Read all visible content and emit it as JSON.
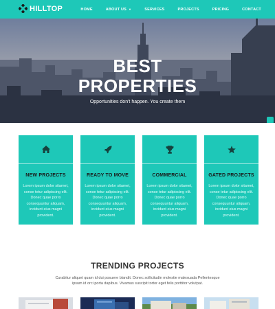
{
  "brand": {
    "name": "HILLTOP",
    "accent_color": "#1ec8b8",
    "logo_icon": "diamond-grid-icon"
  },
  "nav": {
    "items": [
      {
        "label": "HOME",
        "active": true
      },
      {
        "label": "ABOUT US",
        "has_dropdown": true
      },
      {
        "label": "SERVICES"
      },
      {
        "label": "PROJECTS"
      },
      {
        "label": "PRICING"
      },
      {
        "label": "CONTACT"
      }
    ]
  },
  "hero": {
    "title_line1": "BEST",
    "title_line2": "PROPERTIES",
    "subtitle": "Opportunities don't happen. You create them",
    "background": "city-skyline-photo"
  },
  "features": [
    {
      "icon": "home-icon",
      "title": "NEW PROJECTS",
      "text": "Lorem ipsum dolor sitamet, conse tetur adipiscing elit. Donec quae porro consequuntur aliquam, incidunt eius magni provident."
    },
    {
      "icon": "rocket-icon",
      "title": "READY TO MOVE",
      "text": "Lorem ipsum dolor sitamet, conse tetur adipiscing elit. Donec quae porro consequuntur aliquam, incidunt eius magni provident."
    },
    {
      "icon": "trophy-icon",
      "title": "COMMERCIAL",
      "text": "Lorem ipsum dolor sitamet, conse tetur adipiscing elit. Donec quae porro consequuntur aliquam, incidunt eius magni provident."
    },
    {
      "icon": "star-icon",
      "title": "GATED PROJECTS",
      "text": "Lorem ipsum dolor sitamet, conse tetur adipiscing elit. Donec quae porro consequuntur aliquam, incidunt eius magni provident."
    }
  ],
  "trending": {
    "title": "TRENDING PROJECTS",
    "text": "Curabitur aliquet quam id dui posuere blandit. Donec sollicitudin molestie malesuada Pellentesque ipsum id orci porta dapibus. Vivamus suscipit tortor eget felis porttitor volutpat."
  }
}
